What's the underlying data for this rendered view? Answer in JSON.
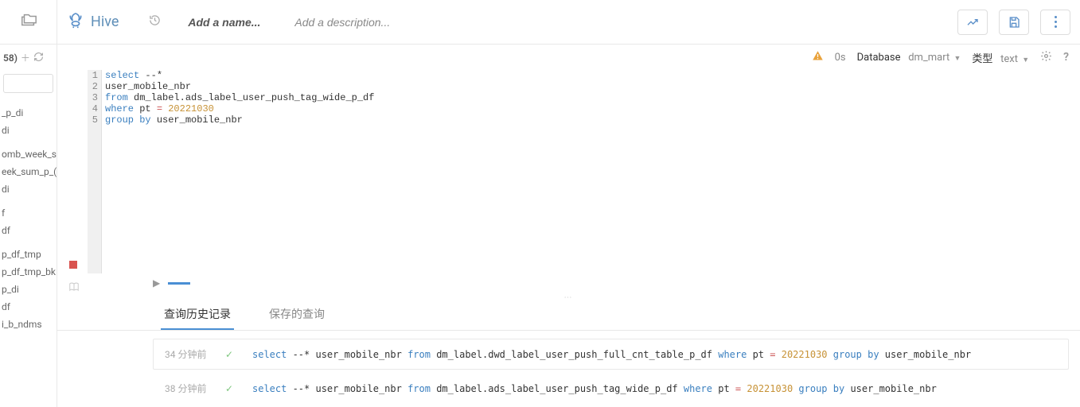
{
  "sidebar": {
    "count_suffix": "58)",
    "items": [
      "",
      "_p_di",
      "di",
      "",
      "omb_week_s",
      "eek_sum_p_(",
      "di",
      "",
      "f",
      "df",
      "",
      "p_df_tmp",
      "p_df_tmp_bk",
      "p_di",
      "df",
      "i_b_ndms"
    ]
  },
  "topbar": {
    "brand": "Hive",
    "name_placeholder": "Add a name...",
    "desc_placeholder": "Add a description..."
  },
  "infobar": {
    "duration": "0s",
    "db_label": "Database",
    "db_value": "dm_mart",
    "type_label": "类型",
    "type_value": "text"
  },
  "editor": {
    "lines": [
      "1",
      "2",
      "3",
      "4",
      "5"
    ],
    "code": {
      "l1": {
        "kw": "select",
        "rest": " --*"
      },
      "l2": "user_mobile_nbr",
      "l3": {
        "kw": "from",
        "rest": " dm_label.ads_label_user_push_tag_wide_p_df"
      },
      "l4": {
        "kw": "where",
        "mid": " pt ",
        "op": "=",
        "sp": " ",
        "num": "20221030"
      },
      "l5": {
        "kw1": "group",
        "sp": " ",
        "kw2": "by",
        "rest": " user_mobile_nbr"
      }
    }
  },
  "tabs": {
    "history": "查询历史记录",
    "saved": "保存的查询"
  },
  "history": [
    {
      "time": "34 分钟前",
      "sql": {
        "p1": "select",
        "p2": " --* user_mobile_nbr ",
        "p3": "from",
        "p4": " dm_label.dwd_label_user_push_full_cnt_table_p_df ",
        "p5": "where",
        "p6": " pt ",
        "p7": "=",
        "p8": " ",
        "p9": "20221030",
        "p10": " ",
        "p11": "group",
        "p12": " ",
        "p13": "by",
        "p14": " user_mobile_nbr"
      }
    },
    {
      "time": "38 分钟前",
      "sql": {
        "p1": "select",
        "p2": " --* user_mobile_nbr ",
        "p3": "from",
        "p4": " dm_label.ads_label_user_push_tag_wide_p_df ",
        "p5": "where",
        "p6": " pt ",
        "p7": "=",
        "p8": " ",
        "p9": "20221030",
        "p10": " ",
        "p11": "group",
        "p12": " ",
        "p13": "by",
        "p14": " user_mobile_nbr"
      }
    }
  ]
}
